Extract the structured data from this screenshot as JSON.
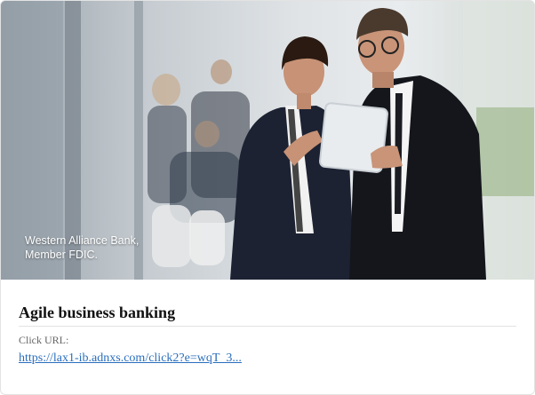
{
  "ad": {
    "image_caption_line1": "Western Alliance Bank,",
    "image_caption_line2": "Member FDIC.",
    "title": "Agile business banking",
    "click_url_label": "Click URL:",
    "click_url_text": "https://lax1-ib.adnxs.com/click2?e=wqT_3..."
  },
  "colors": {
    "link": "#2a6ebd",
    "title": "#111111",
    "label": "#666666"
  }
}
